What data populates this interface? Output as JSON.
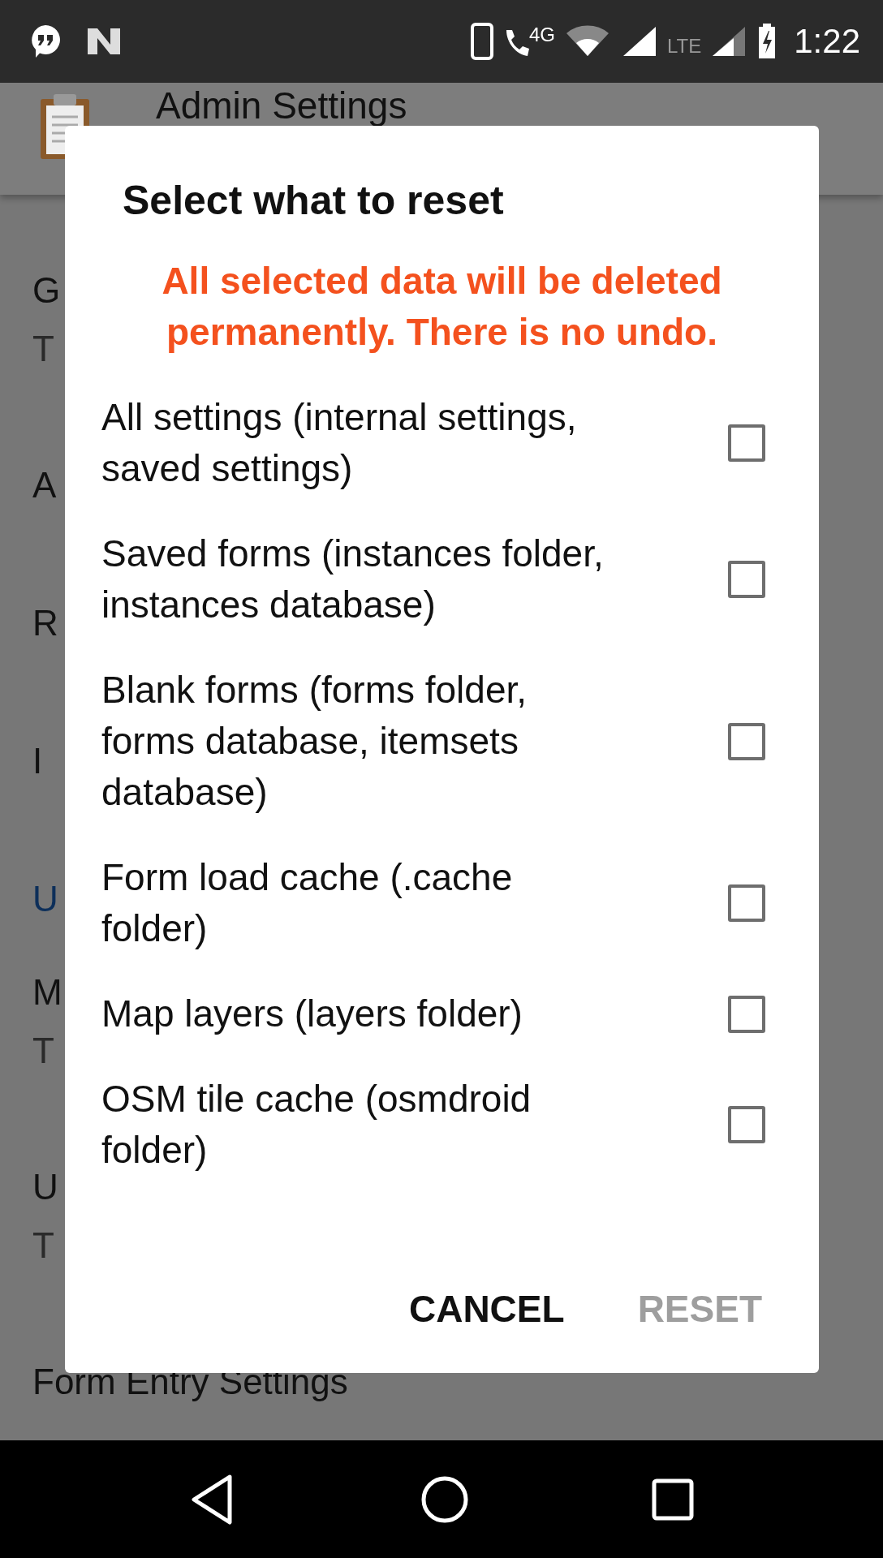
{
  "status_bar": {
    "network_label": "4G",
    "lte_label": "LTE",
    "time": "1:22"
  },
  "app_bar": {
    "title": "Admin Settings"
  },
  "preferences": [
    {
      "kind": "item",
      "title": "G",
      "summary": "T"
    },
    {
      "kind": "item",
      "title": "A"
    },
    {
      "kind": "item",
      "title": "R"
    },
    {
      "kind": "item",
      "title": "I"
    },
    {
      "kind": "category",
      "title": "U"
    },
    {
      "kind": "item",
      "title": "M",
      "summary": "T"
    },
    {
      "kind": "item",
      "title": "U",
      "summary": "T"
    },
    {
      "kind": "item",
      "title": "Form Entry Settings"
    }
  ],
  "dialog": {
    "title": "Select what to reset",
    "warning": "All selected data will be deleted permanently. There is no undo.",
    "options": [
      {
        "label": "All settings (internal settings, saved settings)",
        "checked": false
      },
      {
        "label": "Saved forms (instances folder, instances database)",
        "checked": false
      },
      {
        "label": "Blank forms (forms folder, forms database, itemsets database)",
        "checked": false
      },
      {
        "label": "Form load cache (.cache folder)",
        "checked": false
      },
      {
        "label": "Map layers (layers folder)",
        "checked": false
      },
      {
        "label": "OSM tile cache (osmdroid folder)",
        "checked": false
      }
    ],
    "buttons": [
      {
        "label": "CANCEL",
        "disabled": false
      },
      {
        "label": "RESET",
        "disabled": true
      }
    ]
  }
}
